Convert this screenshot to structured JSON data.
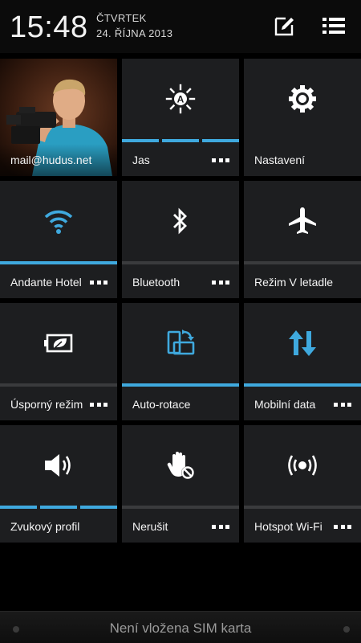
{
  "header": {
    "time": "15:48",
    "day": "ČTVRTEK",
    "date": "24. ŘÍJNA 2013"
  },
  "tiles": [
    {
      "label": "mail@hudus.net",
      "icon": "profile-photo",
      "has_more": false
    },
    {
      "label": "Jas",
      "icon": "brightness-auto-icon",
      "has_more": true,
      "level_segments": 3,
      "level_filled": 3
    },
    {
      "label": "Nastavení",
      "icon": "gear-icon",
      "has_more": false
    },
    {
      "label": "Andante Hotel",
      "icon": "wifi-icon",
      "has_more": true,
      "state": "on"
    },
    {
      "label": "Bluetooth",
      "icon": "bluetooth-icon",
      "has_more": true,
      "state": "off"
    },
    {
      "label": "Režim V letadle",
      "icon": "airplane-icon",
      "has_more": false,
      "state": "off"
    },
    {
      "label": "Úsporný režim",
      "icon": "battery-leaf-icon",
      "has_more": true,
      "state": "off"
    },
    {
      "label": "Auto-rotace",
      "icon": "rotate-icon",
      "has_more": false,
      "state": "on"
    },
    {
      "label": "Mobilní data",
      "icon": "mobile-data-icon",
      "has_more": true,
      "state": "on"
    },
    {
      "label": "Zvukový profil",
      "icon": "speaker-icon",
      "has_more": false,
      "level_segments": 3,
      "level_filled": 3
    },
    {
      "label": "Nerušit",
      "icon": "do-not-disturb-hand-icon",
      "has_more": true,
      "state": "off"
    },
    {
      "label": "Hotspot Wi-Fi",
      "icon": "hotspot-icon",
      "has_more": true,
      "state": "off"
    }
  ],
  "sim_status": "Není vložena SIM karta",
  "colors": {
    "accent": "#3fa9de",
    "tile_bg": "#1d1e20",
    "bar_off": "#3a3b3d"
  }
}
